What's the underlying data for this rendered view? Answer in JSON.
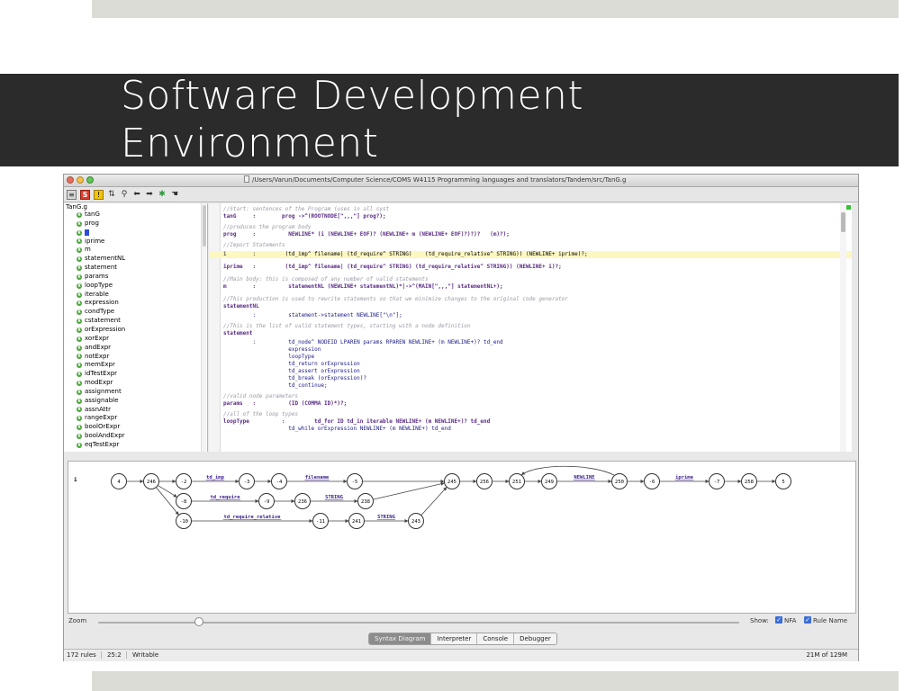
{
  "slide": {
    "title_line1": "Software Development",
    "title_line2": "Environment"
  },
  "window": {
    "title": "/Users/Varun/Documents/Computer Science/COMS W4115 Programming languages and translators/Tandem/src/TanG.g"
  },
  "toolbar": {
    "save_label": "S",
    "warning_label": "!",
    "icons": [
      "grammar-icon",
      "save-icon",
      "warning-icon",
      "sort-icon",
      "search-icon",
      "back-arrow-icon",
      "forward-arrow-icon",
      "debug-icon",
      "hand-icon"
    ]
  },
  "tree": {
    "root": "TanG.g",
    "items": [
      "tanG",
      "prog",
      "",
      "iprime",
      "m",
      "statementNL",
      "statement",
      "params",
      "loopType",
      "iterable",
      "expression",
      "condType",
      "cstatement",
      "orExpression",
      "xorExpr",
      "andExpr",
      "notExpr",
      "memExpr",
      "idTestExpr",
      "modExpr",
      "assignment",
      "assignable",
      "assnAttr",
      "rangeExpr",
      "boolOrExpr",
      "boolAndExpr",
      "eqTestExpr"
    ]
  },
  "editor": {
    "lines": [
      {
        "kind": "cmt",
        "text": "//Start: sentences of the Program (uses in all syst"
      },
      {
        "kind": "rule",
        "text": "tanG     :        prog ->^(ROOTNODE[\",,,\"] prog?);"
      },
      {
        "kind": "cmt",
        "text": "//produces the program body"
      },
      {
        "kind": "rule",
        "text": "prog     :          NEWLINE* (i (NEWLINE+ EOF)? (NEWLINE+ m (NEWLINE+ EOF)?)?)?   (m)?);"
      },
      {
        "kind": "cmt",
        "text": "//Import Statements"
      },
      {
        "kind": "hl",
        "text": "i        :         (td_imp^ filename| (td_require^ STRING)    (td_require_relative^ STRING)) (NEWLINE+ iprime)?;"
      },
      {
        "kind": "rule",
        "text": "iprime   :         (td_imp^ filename| (td_require^ STRING) (td_require_relative^ STRING)) (NEWLINE+ i)?;"
      },
      {
        "kind": "cmt",
        "text": "//Main body: this is composed of any number of valid statements"
      },
      {
        "kind": "rule",
        "text": "m        :          statementNL (NEWLINE+ statementNL)*|->^(MAIN[\",,,\"] statementNL+);"
      },
      {
        "kind": "cmt",
        "text": "//This production is used to rewrite statements so that we minimize changes to the original code generator"
      },
      {
        "kind": "rule",
        "text": "statementNL"
      },
      {
        "kind": "body",
        "text": "         :          statement->statement NEWLINE[\"\\n\"];"
      },
      {
        "kind": "cmt",
        "text": "//This is the list of valid statement types, starting with a node definition"
      },
      {
        "kind": "rule",
        "text": "statement"
      },
      {
        "kind": "body",
        "text": "         :          td_node^ NODEID LPAREN params RPAREN NEWLINE+ (m NEWLINE+)? td_end"
      },
      {
        "kind": "body",
        "text": "                    expression"
      },
      {
        "kind": "body",
        "text": "                    loopType"
      },
      {
        "kind": "body",
        "text": "                    td_return orExpression"
      },
      {
        "kind": "body",
        "text": "                    td_assert orExpression"
      },
      {
        "kind": "body",
        "text": "                    td_break (orExpression)?"
      },
      {
        "kind": "body",
        "text": "                    td_continue;"
      },
      {
        "kind": "cmt",
        "text": "//valid node parameters"
      },
      {
        "kind": "rule",
        "text": "params   :          (ID (COMMA ID)*)?;"
      },
      {
        "kind": "cmt",
        "text": "//all of the loop types"
      },
      {
        "kind": "rule",
        "text": "loopType          :         td_for ID td_in iterable NEWLINE+ (m NEWLINE+)? td_end"
      },
      {
        "kind": "body",
        "text": "                    td_while orExpression NEWLINE+ (m NEWLINE+) td_end"
      }
    ]
  },
  "diagram": {
    "rule_name": "i",
    "nodes": [
      "4",
      "246",
      "-2",
      "-3",
      "-4",
      "-5",
      "-8",
      "-9",
      "236",
      "238",
      "-10",
      "-11",
      "241",
      "243",
      "245",
      "256",
      "251",
      "249",
      "250",
      "-6",
      "-7",
      "258",
      "5"
    ],
    "labels": {
      "td_imp": "td_imp",
      "filename": "filename",
      "td_require": "td_require",
      "string1": "STRING",
      "td_require_relative": "td_require_relative",
      "string2": "STRING",
      "newline": "NEWLINE",
      "iprime": "iprime"
    }
  },
  "zoom": {
    "label": "Zoom",
    "level": 0.15,
    "show_label": "Show:",
    "nfa_label": "NFA",
    "nfa_checked": true,
    "rulename_label": "Rule Name",
    "rulename_checked": true
  },
  "tabs": {
    "items": [
      "Syntax Diagram",
      "Interpreter",
      "Console",
      "Debugger"
    ],
    "active": "Syntax Diagram"
  },
  "status": {
    "rules": "172 rules",
    "position": "25:2",
    "mode": "Writable",
    "memory": "21M of 129M"
  },
  "colors": {
    "title_bar": "#2b2b2b",
    "rule_green": "#4aa43a",
    "highlight_line": "#fdf7c0",
    "edge_label": "#3a1a8a"
  }
}
